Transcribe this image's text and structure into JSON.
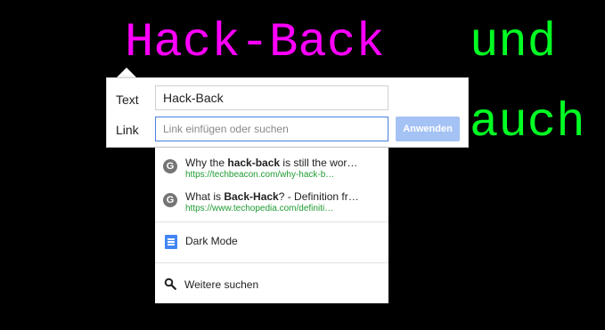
{
  "document": {
    "word_1": "Hack-Back",
    "word_2": "und",
    "word_3": "auch"
  },
  "link_dialog": {
    "text_label": "Text",
    "text_value": "Hack-Back",
    "link_label": "Link",
    "link_value": "",
    "link_placeholder": "Link einfügen oder suchen",
    "apply_label": "Anwenden"
  },
  "suggestions": {
    "items": [
      {
        "icon": "google-icon",
        "title_pre": "Why the ",
        "title_bold": "hack-back",
        "title_post": " is still the wor…",
        "url": "https://techbeacon.com/why-hack-b…"
      },
      {
        "icon": "google-icon",
        "title_pre": "What is ",
        "title_bold": "Back-Hack",
        "title_post": "? - Definition fr…",
        "url": "https://www.techopedia.com/definiti…"
      }
    ],
    "doc_item": {
      "icon": "google-docs-icon",
      "label": "Dark Mode"
    },
    "more_item": {
      "icon": "search-icon",
      "label": "Weitere suchen"
    }
  },
  "colors": {
    "background": "#000000",
    "magenta_text": "#ff00ff",
    "green_text": "#00ff22",
    "url_green": "#1e9c32",
    "apply_button": "#a5c2f4",
    "focus_border": "#4a7fe0"
  }
}
